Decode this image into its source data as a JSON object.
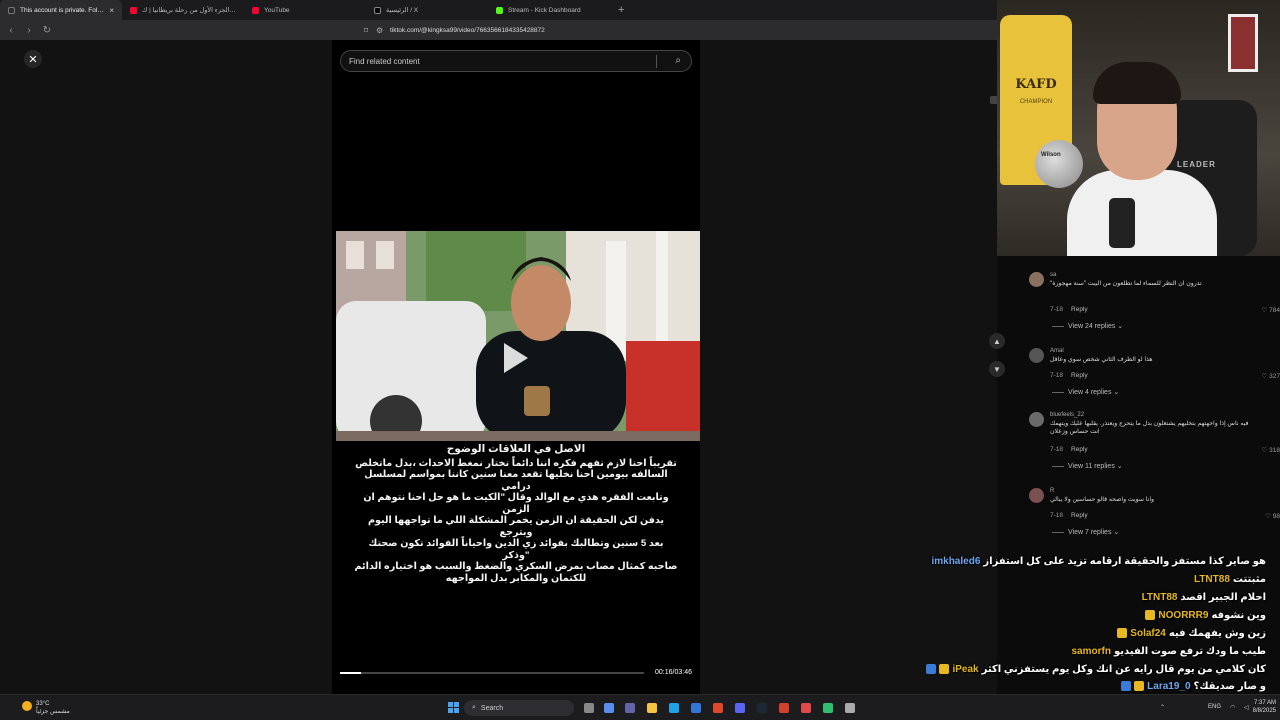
{
  "browser": {
    "tabs": [
      {
        "label": "This account is private. Follow th",
        "color": "#2b2b2b",
        "active": true
      },
      {
        "label": "طلوق الجزء الأول من رحلة بريطانيا | ك",
        "color": "#ff0033"
      },
      {
        "label": "YouTube",
        "color": "#ff0033"
      },
      {
        "label": "الرئيسية / X",
        "color": "#000000"
      },
      {
        "label": "Stream - Kick Dashboard",
        "color": "#53fc18"
      }
    ],
    "new_tab": "+",
    "url": "tiktok.com/@kingksa99/video/7663566184335428872"
  },
  "page": {
    "close_icon": "✕",
    "search_placeholder": "Find related content",
    "caption_title": "الاصل في العلاقات الوضوح",
    "caption_lines": [
      "تقريباً احنا لازم نفهم فكره اننا دائماً نختار نمغط الاحداث ،بدل ماتخلص",
      "السالفه بيومين احنا نخليها تقعد معنا سنين كاننا بمواسم لمسلسل درامي",
      "وتابعت الفقره هذي مع الوالد وقال \"الكيت ما هو حل احنا نتوهم ان الزمن",
      "يدفن لكن الحقيقة ان الزمن يخمر المشكلة اللي ما تواجهها اليوم وبترجع",
      "بعد 5 سنين وتطالبك بفوائد زي الدين واحياناً الفوائد تكون صحتك \"وذكر",
      "صاحبه كمثال مصاب بمرض السكري والضغط والسبب هو اختياره الدائم",
      "للكتمان والمكابر بدل المواجهه"
    ],
    "progress": 0.07,
    "timecode": "00:16/03:46"
  },
  "webcam": {
    "jersey_text": "KAFD",
    "jersey_sub": "CHAMPION",
    "ball_text": "Wilson",
    "chair_text": "LEADER"
  },
  "comments": [
    {
      "user": "sa",
      "text": "تدرون ان النظر للسماء لما تطلعون من البيت \"سنة مهجورة\"",
      "date": "7-18",
      "reply": "Reply",
      "likes": "784",
      "view_replies": "View 24 replies"
    },
    {
      "user": "Amal",
      "text": "هذا لو الطرف الثاني شخص سوي وعاقل",
      "date": "7-18",
      "reply": "Reply",
      "likes": "327",
      "view_replies": "View 4 replies"
    },
    {
      "user": "bluefeels_22",
      "text": "فيه ناس إذا واجهتهم بتخليهم يشتغلون بدل ما يتحرج ويعتذر. يقلبها عليك ويتهمك انت حساس وزعلان",
      "date": "7-18",
      "reply": "Reply",
      "likes": "318",
      "view_replies": "View 11 replies"
    },
    {
      "user": "R",
      "text": "وانا سويت واصحه قالو حساسين ولا يبالي",
      "date": "7-18",
      "reply": "Reply",
      "likes": "98",
      "view_replies": "View 7 replies"
    }
  ],
  "chat": [
    {
      "user": "imkhaled6",
      "msg": "هو صاير كذا مستفز والحقيقة ارقامه تزيد على كل استفزاز",
      "blue": true,
      "badge": false
    },
    {
      "user": "LTNT88",
      "msg": "مثبتتت",
      "blue": false,
      "badge": false
    },
    {
      "user": "LTNT88",
      "msg": "احلام الجبير اقصد",
      "blue": false,
      "badge": false
    },
    {
      "user": "NOORRR9",
      "msg": "وين نشوفه",
      "blue": false,
      "badge": true
    },
    {
      "user": "Solaf24",
      "msg": "زين وش يفهمك فيه",
      "blue": false,
      "badge": true
    },
    {
      "user": "samorfn",
      "msg": "طيب ما ودك ترفع صوت الفيديو",
      "blue": false,
      "badge": false
    },
    {
      "user": "iPeak",
      "msg": "كان كلامي من يوم قال رايه عن انك وكل يوم يستفزني اكثر",
      "blue": true,
      "badge": true
    },
    {
      "user": "Lara19_0",
      "msg": "و صار صديقك؟",
      "blue": true,
      "badge": true
    }
  ],
  "taskbar": {
    "temp": "33°C",
    "weather_desc": "مشمس جزئياً",
    "search_label": "Search",
    "lang": "ENG",
    "time": "7:37 AM",
    "date": "8/8/2025"
  }
}
